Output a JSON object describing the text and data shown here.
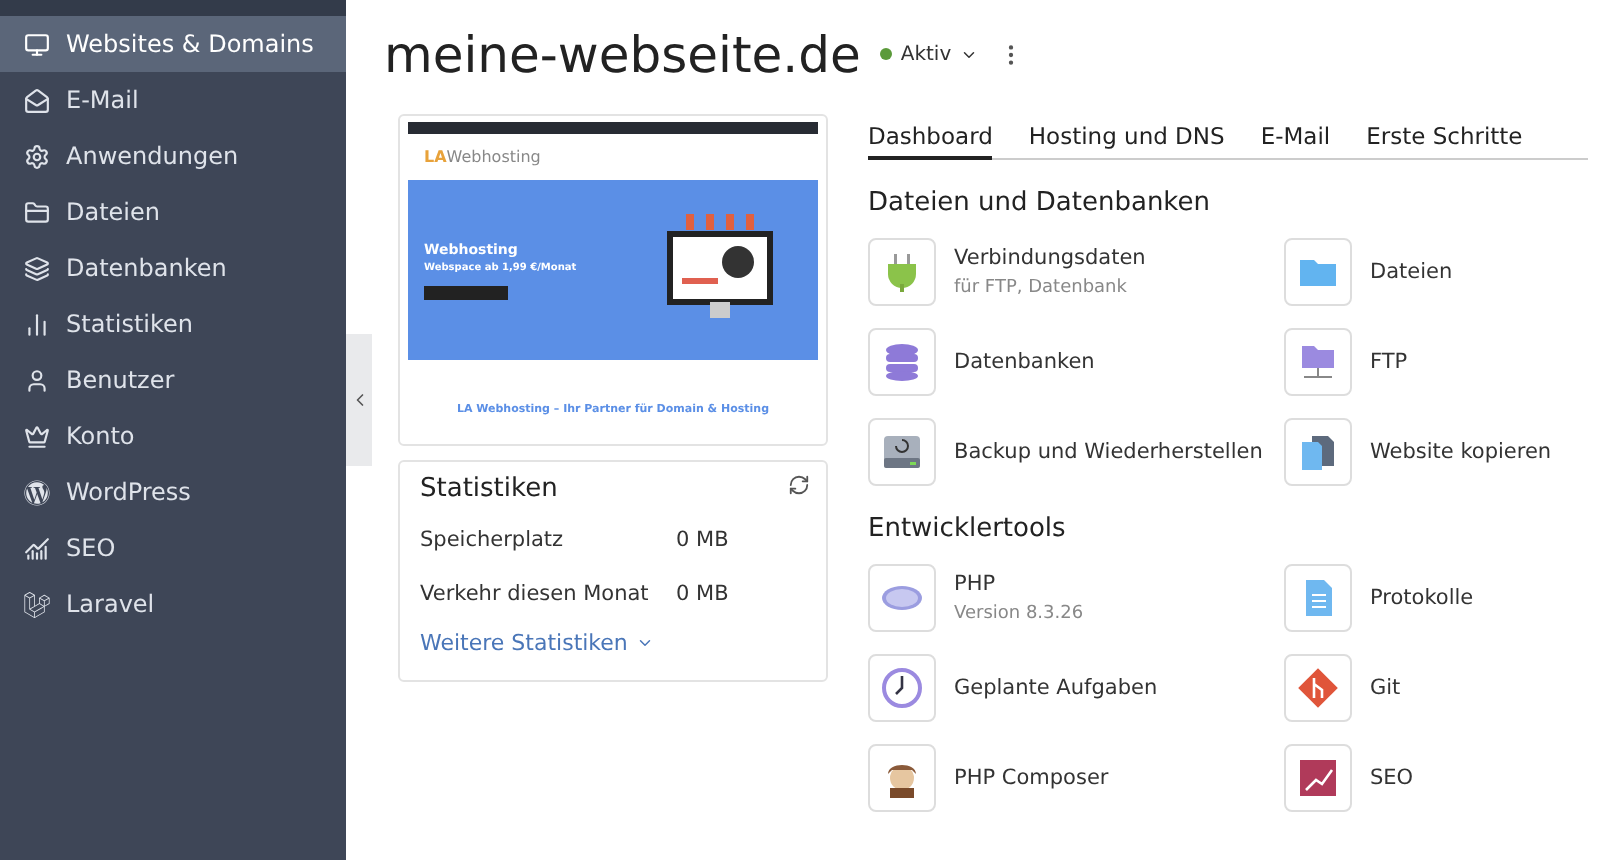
{
  "sidebar": {
    "items": [
      {
        "label": "Websites & Domains",
        "selected": true
      },
      {
        "label": "E-Mail",
        "selected": false
      },
      {
        "label": "Anwendungen",
        "selected": false
      },
      {
        "label": "Dateien",
        "selected": false
      },
      {
        "label": "Datenbanken",
        "selected": false
      },
      {
        "label": "Statistiken",
        "selected": false
      },
      {
        "label": "Benutzer",
        "selected": false
      },
      {
        "label": "Konto",
        "selected": false
      },
      {
        "label": "WordPress",
        "selected": false
      },
      {
        "label": "SEO",
        "selected": false
      },
      {
        "label": "Laravel",
        "selected": false
      }
    ]
  },
  "header": {
    "title": "meine-webseite.de",
    "status": "Aktiv"
  },
  "preview": {
    "logo_mark": "LA",
    "logo_text": "Webhosting",
    "hero_title": "Webhosting",
    "hero_subtitle": "Webspace ab 1,99 €/Monat",
    "tagline": "LA Webhosting – Ihr Partner für Domain & Hosting"
  },
  "statistics": {
    "title": "Statistiken",
    "rows": [
      {
        "label": "Speicherplatz",
        "value": "0 MB"
      },
      {
        "label": "Verkehr diesen Monat",
        "value": "0 MB"
      }
    ],
    "more_link": "Weitere Statistiken"
  },
  "tabs": [
    {
      "label": "Dashboard",
      "selected": true
    },
    {
      "label": "Hosting und DNS",
      "selected": false
    },
    {
      "label": "E-Mail",
      "selected": false
    },
    {
      "label": "Erste Schritte",
      "selected": false
    }
  ],
  "sections": [
    {
      "title": "Dateien und Datenbanken",
      "items": [
        {
          "label": "Verbindungsdaten",
          "sub": "für FTP, Datenbank"
        },
        {
          "label": "Dateien"
        },
        {
          "label": "Datenbanken"
        },
        {
          "label": "FTP"
        },
        {
          "label": "Backup und Wiederherstellen"
        },
        {
          "label": "Website kopieren"
        }
      ]
    },
    {
      "title": "Entwicklertools",
      "items": [
        {
          "label": "PHP",
          "sub": "Version 8.3.26"
        },
        {
          "label": "Protokolle"
        },
        {
          "label": "Geplante Aufgaben"
        },
        {
          "label": "Git"
        },
        {
          "label": "PHP Composer"
        },
        {
          "label": "SEO"
        }
      ]
    }
  ]
}
